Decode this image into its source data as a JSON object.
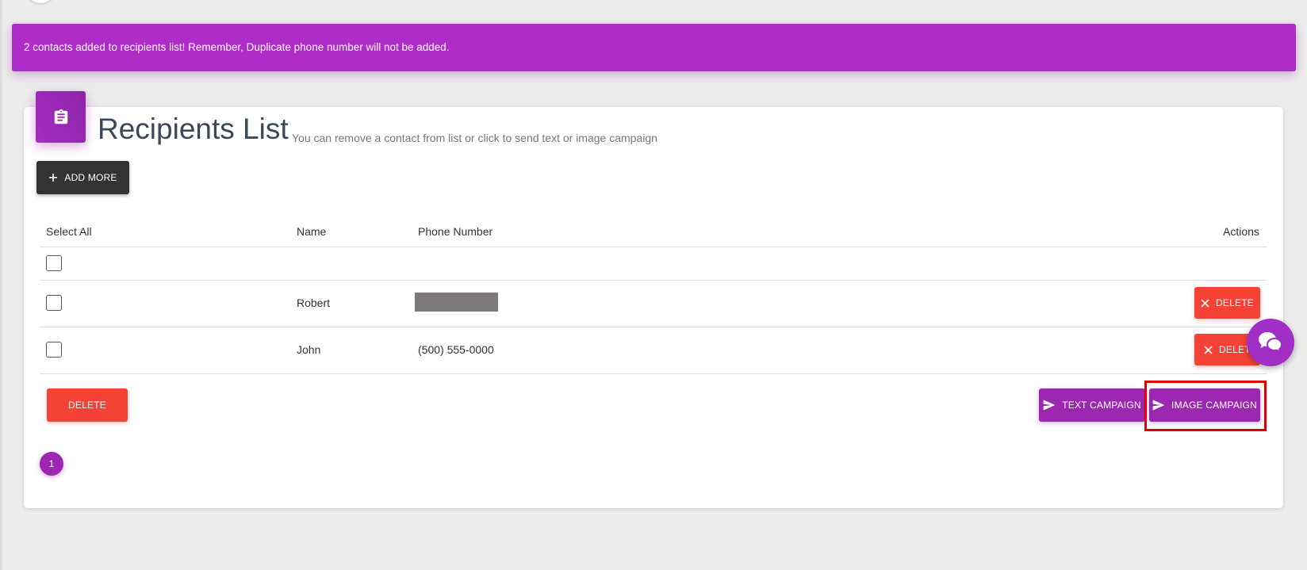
{
  "notification": {
    "message": "2 contacts added to recipients list! Remember, Duplicate phone number will not be added."
  },
  "card": {
    "icon": "clipboard-icon",
    "title": "Recipients List",
    "subtitle": "You can remove a contact from list or click to send text or image campaign",
    "add_more_label": "ADD MORE"
  },
  "table": {
    "headers": {
      "select_all": "Select All",
      "name": "Name",
      "phone": "Phone Number",
      "actions": "Actions"
    },
    "rows": [
      {
        "name": "Robert",
        "phone": "",
        "phone_redacted": true,
        "delete_label": "DELETE"
      },
      {
        "name": "John",
        "phone": "(500) 555-0000",
        "phone_redacted": false,
        "delete_label": "DELET"
      }
    ]
  },
  "footer_actions": {
    "delete_label": "DELETE",
    "text_campaign_label": "TEXT CAMPAIGN",
    "image_campaign_label": "IMAGE CAMPAIGN"
  },
  "pagination": {
    "current_page": "1"
  },
  "colors": {
    "brand_purple": "#9c27b0",
    "notice_purple": "#ae2cc8",
    "danger_red": "#f44336",
    "dark_button": "#333333",
    "highlight_red": "#e00000"
  },
  "icons": {
    "add": "plus-icon",
    "delete": "close-icon",
    "send": "send-icon",
    "chat": "chat-bubbles-icon"
  }
}
